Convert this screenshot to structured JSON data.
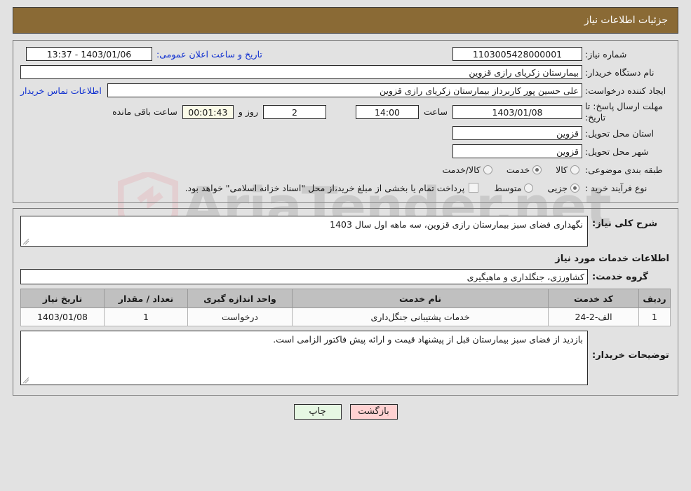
{
  "header": {
    "title": "جزئیات اطلاعات نیاز"
  },
  "watermark": {
    "text": "AriaTender.net"
  },
  "form": {
    "need_number_label": "شماره نیاز:",
    "need_number_value": "1103005428000001",
    "announce_datetime_label": "تاریخ و ساعت اعلان عمومی:",
    "announce_datetime_value": "1403/01/06 - 13:37",
    "buyer_org_label": "نام دستگاه خریدار:",
    "buyer_org_value": "بیمارستان زکریای رازی قزوین",
    "creator_label": "ایجاد کننده درخواست:",
    "creator_value": "علی حسین پور کاربرداز بیمارستان زکریای رازی قزوین",
    "contact_link": "اطلاعات تماس خریدار",
    "deadline_label": "مهلت ارسال پاسخ: تا تاریخ:",
    "deadline_date": "1403/01/08",
    "hour_label": "ساعت",
    "deadline_hour": "14:00",
    "days_value": "2",
    "days_label": "روز و",
    "countdown_value": "00:01:43",
    "remaining_label": "ساعت باقی مانده",
    "province_label": "استان محل تحویل:",
    "province_value": "قزوین",
    "city_label": "شهر محل تحویل:",
    "city_value": "قزوین",
    "category_label": "طبقه بندی موضوعی:",
    "category_options": [
      {
        "label": "کالا",
        "selected": false
      },
      {
        "label": "خدمت",
        "selected": true
      },
      {
        "label": "کالا/خدمت",
        "selected": false
      }
    ],
    "process_label": "نوع فرآیند خرید :",
    "process_options": [
      {
        "label": "جزیی",
        "selected": true
      },
      {
        "label": "متوسط",
        "selected": false
      }
    ],
    "treasury_checkbox_label": "پرداخت تمام یا بخشی از مبلغ خرید،از محل \"اسناد خزانه اسلامی\" خواهد بود.",
    "treasury_checked": false
  },
  "details": {
    "general_desc_label": "شرح کلی نیاز:",
    "general_desc_value": "نگهداری فضای سبز بیمارستان رازی قزوین، سه ماهه اول سال 1403",
    "services_section_title": "اطلاعات خدمات مورد نیاز",
    "service_group_label": "گروه خدمت:",
    "service_group_value": "کشاورزی، جنگلداری و ماهیگیری",
    "buyer_notes_label": "توضیحات خریدار:",
    "buyer_notes_value": "بازدید از فضای سبز بیمارستان قبل از پیشنهاد قیمت و ارائه پیش فاکتور الزامی است."
  },
  "items_table": {
    "columns": [
      "ردیف",
      "کد خدمت",
      "نام خدمت",
      "واحد اندازه گیری",
      "تعداد / مقدار",
      "تاریخ نیاز"
    ],
    "rows": [
      {
        "index": "1",
        "code": "الف-2-24",
        "name": "خدمات پشتیبانی جنگل‌داری",
        "unit": "درخواست",
        "qty": "1",
        "date": "1403/01/08"
      }
    ]
  },
  "buttons": {
    "back": "بازگشت",
    "print": "چاپ"
  }
}
